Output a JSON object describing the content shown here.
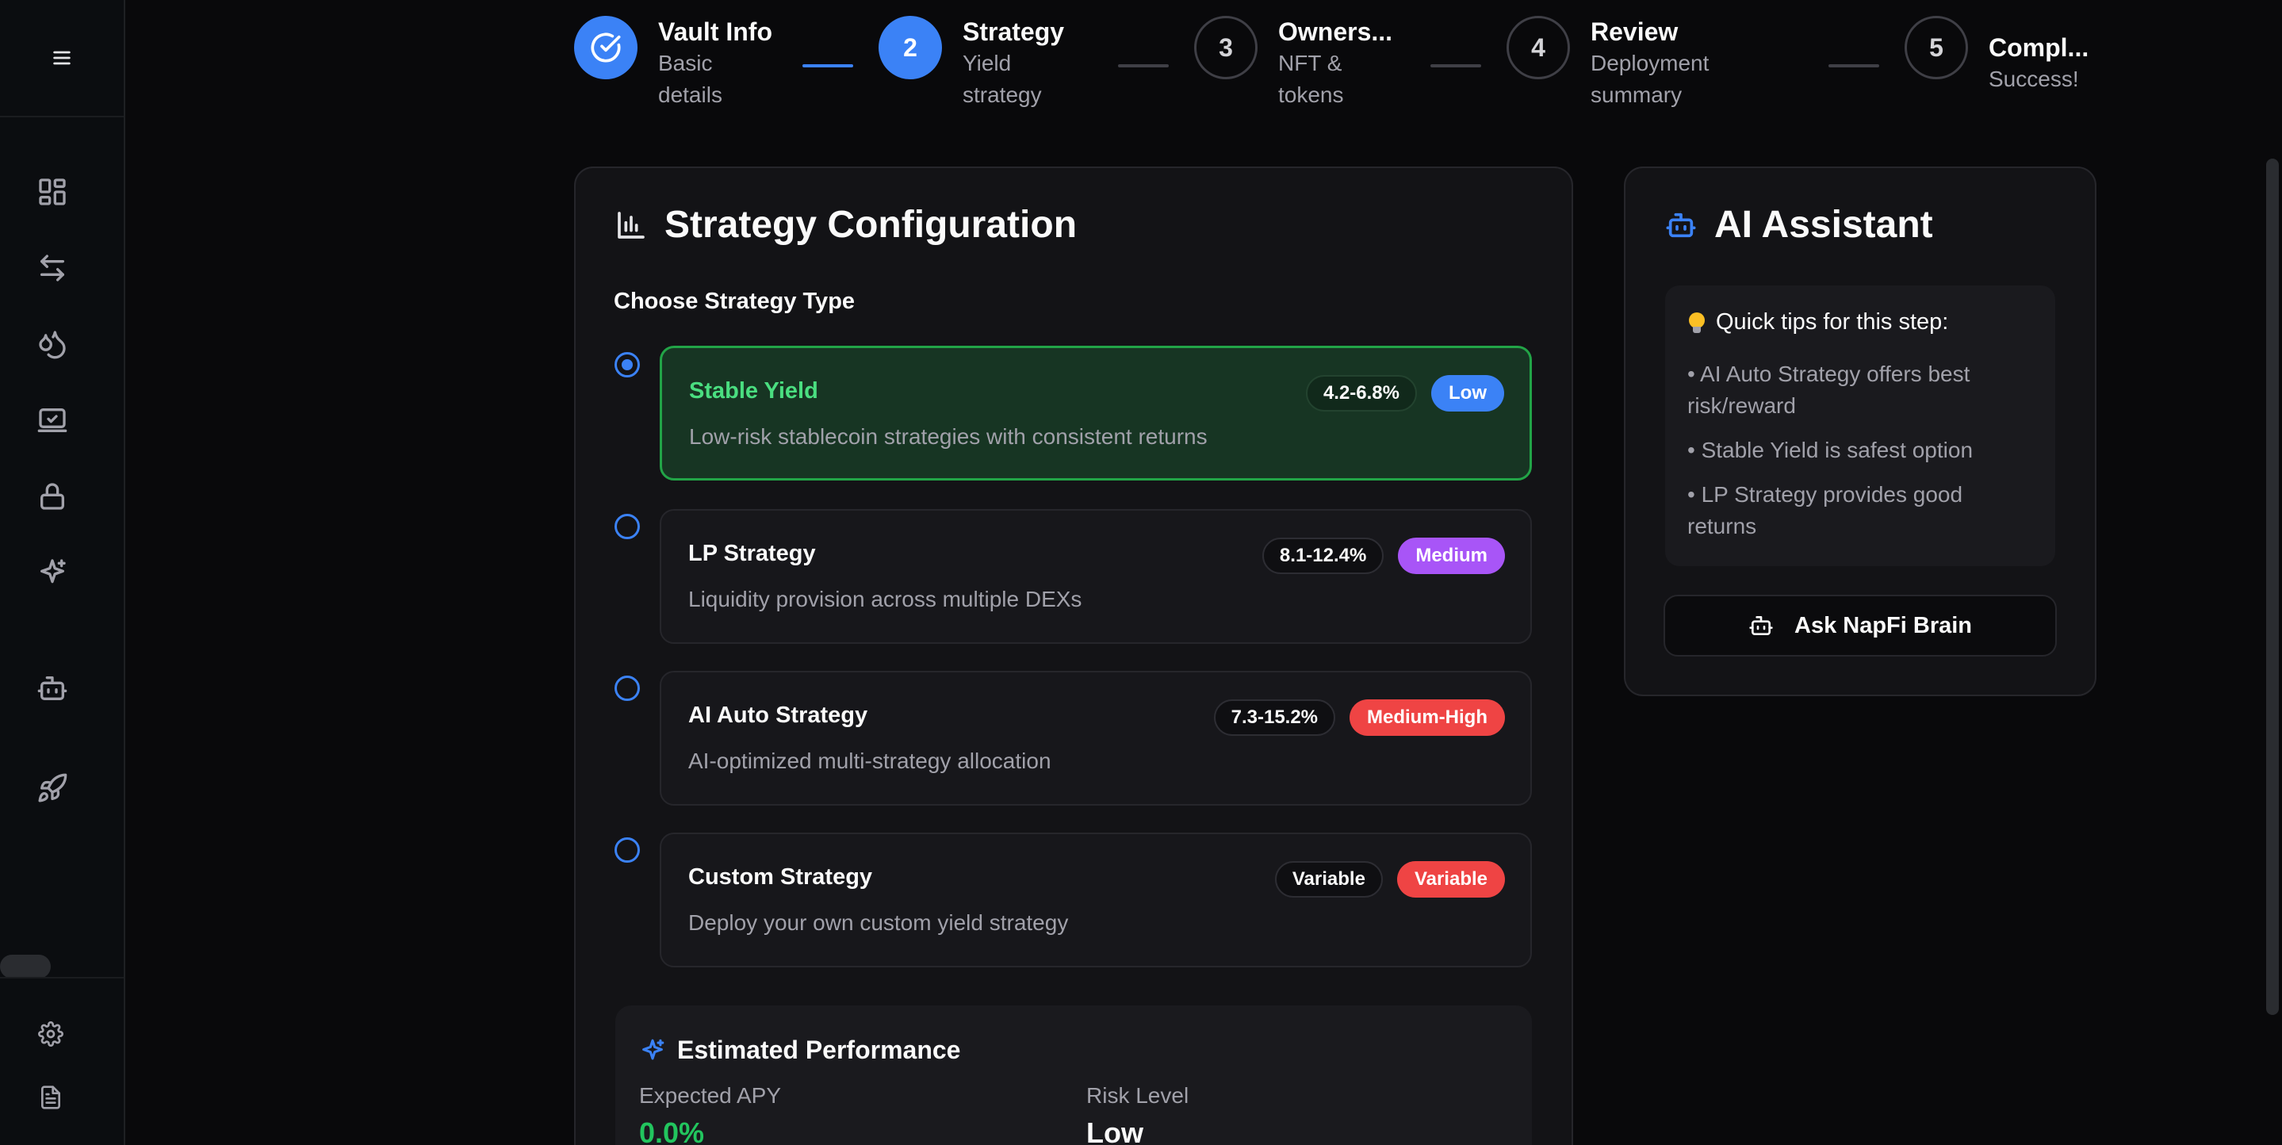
{
  "sidebar": {
    "icons": [
      "menu-icon",
      "dashboard-icon",
      "swap-icon",
      "liquidity-icon",
      "vault-icon",
      "lock-icon",
      "sparkles-icon",
      "bot-icon",
      "rocket-icon",
      "settings-icon",
      "document-icon"
    ]
  },
  "stepper": {
    "steps": [
      {
        "number": "",
        "title": "Vault Info",
        "subtitle_line1": "Basic",
        "subtitle_line2": "details",
        "state": "completed"
      },
      {
        "number": "2",
        "title": "Strategy",
        "subtitle_line1": "Yield",
        "subtitle_line2": "strategy",
        "state": "active"
      },
      {
        "number": "3",
        "title": "Owners...",
        "subtitle_line1": "NFT &",
        "subtitle_line2": "tokens",
        "state": "pending"
      },
      {
        "number": "4",
        "title": "Review",
        "subtitle_line1": "Deployment",
        "subtitle_line2": "summary",
        "state": "pending"
      },
      {
        "number": "5",
        "title": "Compl...",
        "subtitle_line1": "Success!",
        "subtitle_line2": "",
        "state": "pending"
      }
    ]
  },
  "strategy_card": {
    "title": "Strategy Configuration",
    "section_label": "Choose Strategy Type",
    "options": [
      {
        "name": "Stable Yield",
        "description": "Low-risk stablecoin strategies with consistent returns",
        "apy": "4.2-6.8%",
        "risk": "Low",
        "risk_color": "#3b82f6",
        "selected": true
      },
      {
        "name": "LP Strategy",
        "description": "Liquidity provision across multiple DEXs",
        "apy": "8.1-12.4%",
        "risk": "Medium",
        "risk_color": "#a855f7",
        "selected": false
      },
      {
        "name": "AI Auto Strategy",
        "description": "AI-optimized multi-strategy allocation",
        "apy": "7.3-15.2%",
        "risk": "Medium-High",
        "risk_color": "#ef4444",
        "selected": false
      },
      {
        "name": "Custom Strategy",
        "description": "Deploy your own custom yield strategy",
        "apy": "Variable",
        "risk": "Variable",
        "risk_color": "#ef4444",
        "selected": false
      }
    ],
    "performance": {
      "title": "Estimated Performance",
      "expected_apy_label": "Expected APY",
      "expected_apy_value": "0.0%",
      "risk_level_label": "Risk Level",
      "risk_level_value": "Low"
    }
  },
  "assistant": {
    "title": "AI Assistant",
    "tips_title": "Quick tips for this step:",
    "tips": [
      "• AI Auto Strategy offers best risk/reward",
      "• Stable Yield is safest option",
      "• LP Strategy provides good returns"
    ],
    "ask_button": "Ask NapFi Brain"
  },
  "colors": {
    "accent": "#3b82f6",
    "success": "#22c55e",
    "background": "#09090b",
    "card": "#131316"
  }
}
